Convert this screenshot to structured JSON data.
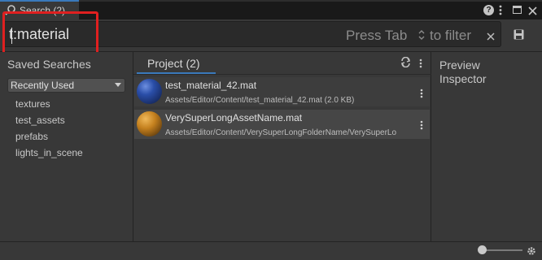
{
  "window": {
    "tab_title": "Search (2)"
  },
  "search": {
    "query": "t:material",
    "hint_a": "Press Tab",
    "hint_b": "to filter"
  },
  "sidebar": {
    "title": "Saved Searches",
    "dropdown_value": "Recently Used",
    "items": [
      {
        "label": "textures"
      },
      {
        "label": "test_assets"
      },
      {
        "label": "prefabs"
      },
      {
        "label": "lights_in_scene"
      }
    ]
  },
  "results": {
    "tab_label": "Project (2)",
    "rows": [
      {
        "name": "test_material_42.mat",
        "path": "Assets/Editor/Content/test_material_42.mat (2.0 KB)"
      },
      {
        "name": "VerySuperLongAssetName.mat",
        "path": "Assets/Editor/Content/VerySuperLongFolderName/VerySuperLo"
      }
    ]
  },
  "inspector": {
    "line1": "Preview",
    "line2": "Inspector"
  },
  "icons": {
    "search": "search-icon",
    "help": "help-icon",
    "menu": "menu-dots-icon",
    "maximize": "maximize-icon",
    "close": "close-icon",
    "tab_toggle": "tab-filter-icon",
    "clear": "clear-icon",
    "save": "save-icon",
    "refresh": "refresh-icon",
    "settings": "gear-icon"
  },
  "colors": {
    "accent": "#3a79bb",
    "highlight": "#e02020"
  }
}
